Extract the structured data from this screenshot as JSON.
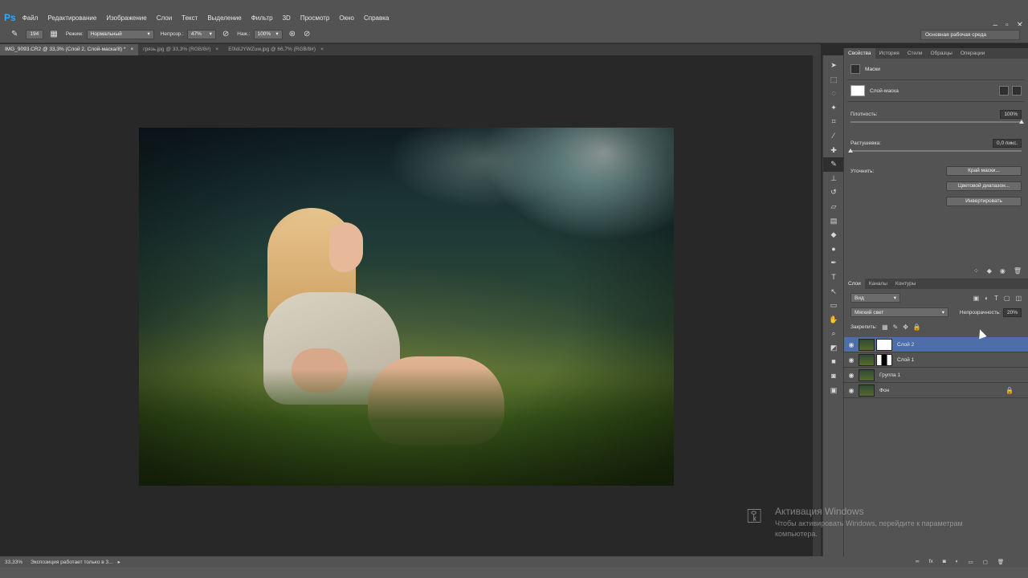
{
  "app": {
    "logo": "Ps"
  },
  "menu": [
    "Файл",
    "Редактирование",
    "Изображение",
    "Слои",
    "Текст",
    "Выделение",
    "Фильтр",
    "3D",
    "Просмотр",
    "Окно",
    "Справка"
  ],
  "window_controls": {
    "min": "–",
    "restore": "▫",
    "close": "✕"
  },
  "options": {
    "brush_size": "194",
    "mode_label": "Режим:",
    "mode_value": "Нормальный",
    "opacity_label": "Непрозр.:",
    "opacity_value": "47%",
    "pressure_label": "Наж.:",
    "pressure_value": "100%",
    "workspace": "Основная рабочая среда"
  },
  "tabs": [
    {
      "label": "IMG_9093.CR2 @ 33,3% (Слой 2, Слой-маска/8) *",
      "close": "×"
    },
    {
      "label": "грязь.jpg @ 33,3% (RGB/8#)",
      "close": "×"
    },
    {
      "label": "E0ldIJYWZuw.jpg @ 66,7% (RGB/8#)",
      "close": "×"
    }
  ],
  "properties": {
    "tabs": [
      "Свойства",
      "История",
      "Стили",
      "Образцы",
      "Операции"
    ],
    "title": "Маски",
    "mask_type": "Слой-маска",
    "density_label": "Плотность:",
    "density_value": "100%",
    "density_level": 1.0,
    "feather_label": "Растушевка:",
    "feather_value": "0,0 пикс.",
    "feather_level": 0.0,
    "refine_label": "Уточнить:",
    "btn_mask_edge": "Край маски...",
    "btn_color_range": "Цветовой диапазон...",
    "btn_invert": "Инвертировать"
  },
  "layers_panel": {
    "tabs": [
      "Слои",
      "Каналы",
      "Контуры"
    ],
    "filter": "Вид",
    "blend": "Мягкий свет",
    "opacity_label": "Непрозрачность:",
    "opacity_value": "20%",
    "lock_label": "Закрепить:",
    "layers": [
      {
        "name": "Слой 2",
        "selected": true
      },
      {
        "name": "Слой 1",
        "selected": false
      },
      {
        "name": "Группа 1",
        "selected": false
      },
      {
        "name": "Фон",
        "selected": false
      }
    ]
  },
  "status": {
    "zoom": "33,33%",
    "text": "Экспозиция работает только в 3..."
  },
  "activation": {
    "title": "Активация Windows",
    "subtitle": "Чтобы активировать Windows, перейдите к параметрам компьютера."
  }
}
